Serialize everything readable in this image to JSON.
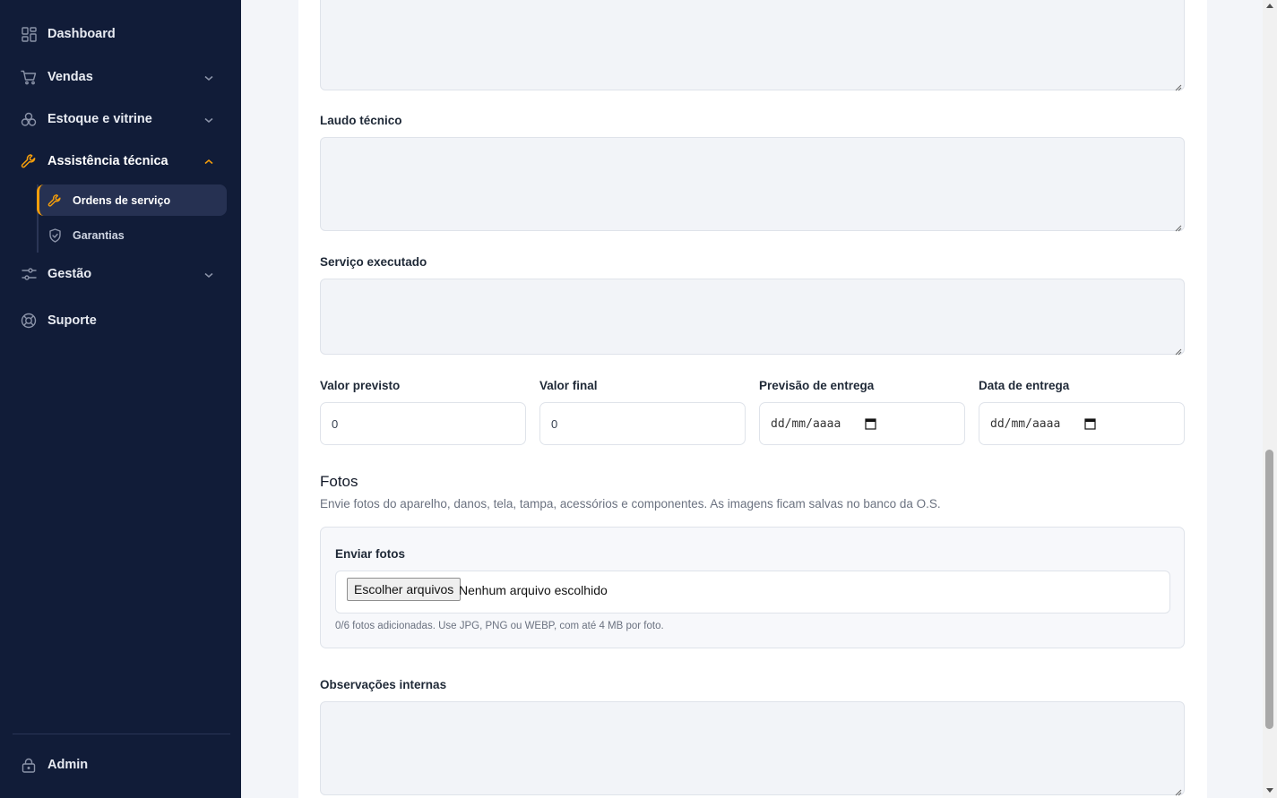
{
  "sidebar": {
    "items": [
      {
        "label": "Dashboard",
        "icon": "grid-icon"
      },
      {
        "label": "Vendas",
        "icon": "cart-icon"
      },
      {
        "label": "Estoque e vitrine",
        "icon": "boxes-icon"
      },
      {
        "label": "Assistência técnica",
        "icon": "wrench-icon"
      },
      {
        "label": "Gestão",
        "icon": "sliders-icon"
      },
      {
        "label": "Suporte",
        "icon": "lifebuoy-icon"
      }
    ],
    "subitems": [
      {
        "label": "Ordens de serviço",
        "icon": "wrench-icon"
      },
      {
        "label": "Garantias",
        "icon": "shield-icon"
      }
    ],
    "footer": {
      "label": "Admin",
      "icon": "lock-icon"
    }
  },
  "form": {
    "laudo_label": "Laudo técnico",
    "servico_label": "Serviço executado",
    "valor_previsto": {
      "label": "Valor previsto",
      "value": "0"
    },
    "valor_final": {
      "label": "Valor final",
      "value": "0"
    },
    "previsao_entrega": {
      "label": "Previsão de entrega",
      "value": "dd/mm/aaaa"
    },
    "data_entrega": {
      "label": "Data de entrega",
      "value": "dd/mm/aaaa"
    },
    "observacoes_label": "Observações internas"
  },
  "fotos": {
    "title": "Fotos",
    "description": "Envie fotos do aparelho, danos, tela, tampa, acessórios e componentes. As imagens ficam salvas no banco da O.S.",
    "upload_label": "Enviar fotos",
    "choose_button": "Escolher arquivos",
    "no_file": "Nenhum arquivo escolhido",
    "hint": "0/6 fotos adicionadas. Use JPG, PNG ou WEBP, com até 4 MB por foto."
  },
  "colors": {
    "sidebar_bg": "#111c38",
    "accent": "#f59e0b",
    "active_bg": "#263152"
  }
}
